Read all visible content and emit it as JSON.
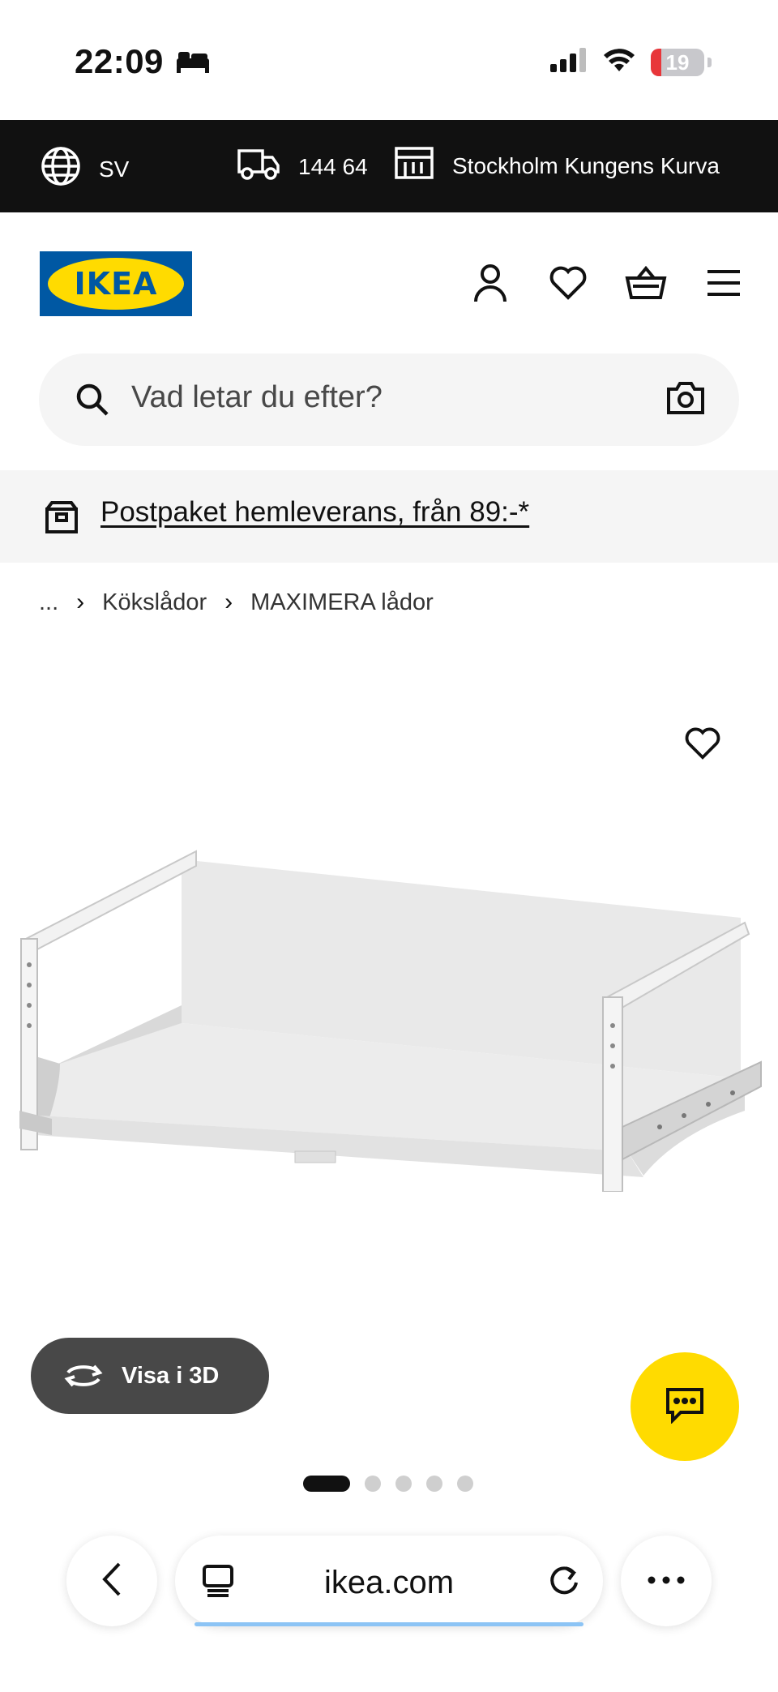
{
  "status_bar": {
    "time": "22:09",
    "battery": "19",
    "battery_level": 0.19,
    "icons": [
      "bed-icon",
      "signal-icon",
      "wifi-icon",
      "battery-icon"
    ]
  },
  "top_bar": {
    "language": "SV",
    "postal_code": "144 64",
    "store": "Stockholm Kungens Kurva",
    "icons": [
      "globe-icon",
      "truck-icon",
      "store-icon"
    ]
  },
  "header": {
    "logo": "IKEA",
    "icons": [
      "user-icon",
      "heart-icon",
      "basket-icon",
      "menu-icon"
    ]
  },
  "search": {
    "placeholder": "Vad letar du efter?",
    "icons": [
      "search-icon",
      "camera-icon"
    ]
  },
  "promo": {
    "text": "Postpaket hemleverans, från 89:-*",
    "icon": "package-icon"
  },
  "breadcrumb": {
    "items": [
      "...",
      "Kökslådor",
      "MAXIMERA lådor"
    ]
  },
  "product": {
    "view_3d_label": "Visa i 3D",
    "image_count": 5,
    "active_image": 1,
    "colors": {
      "chat_button": "#ffdb00",
      "view_3d_button": "#484848"
    }
  },
  "browser": {
    "url": "ikea.com"
  },
  "colors": {
    "ikea_blue": "#0058a3",
    "ikea_yellow": "#ffdb00",
    "top_bar": "#111111",
    "battery_low": "#e8363a"
  }
}
